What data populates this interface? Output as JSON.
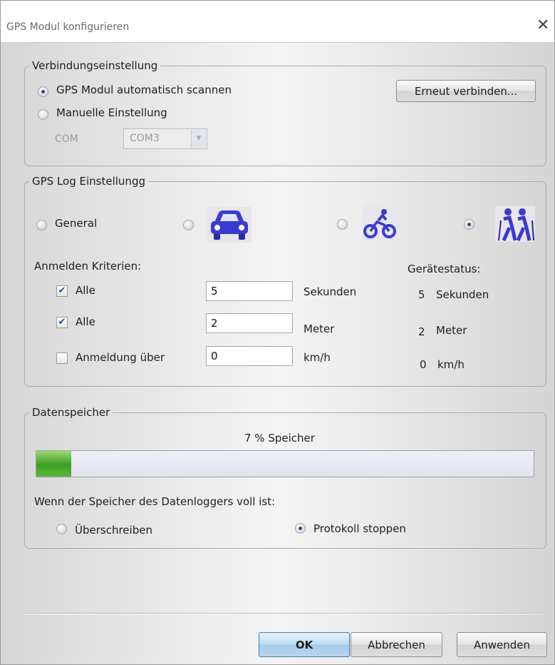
{
  "window": {
    "title": "GPS Modul konfigurieren"
  },
  "connection": {
    "legend": "Verbindungseinstellung",
    "auto_label": "GPS Modul automatisch scannen",
    "manual_label": "Manuelle Einstellung",
    "com_label": "COM",
    "com_value": "COM3",
    "reconnect_label": "Erneut verbinden...",
    "selected": "auto"
  },
  "log": {
    "legend": "GPS Log Einstellungg",
    "modes": [
      {
        "label": "General",
        "icon": "none"
      },
      {
        "label": "",
        "icon": "car-icon"
      },
      {
        "label": "",
        "icon": "bicycle-icon"
      },
      {
        "label": "",
        "icon": "hiking-icon"
      }
    ],
    "selected_mode": 3,
    "criteria_label": "Anmelden Kriterien:",
    "status_label": "Gerätestatus:",
    "criteria": [
      {
        "label": "Alle",
        "checked": true,
        "value": "5",
        "unit": "Sekunden",
        "status_value": "5",
        "status_unit": "Sekunden"
      },
      {
        "label": "Alle",
        "checked": true,
        "value": "2",
        "unit": "Meter",
        "status_value": "2",
        "status_unit": "Meter"
      },
      {
        "label": "Anmeldung über",
        "checked": false,
        "value": "0",
        "unit": "km/h",
        "status_value": "0",
        "status_unit": "km/h"
      }
    ]
  },
  "storage": {
    "legend": "Datenspeicher",
    "usage_text": "7 % Speicher",
    "usage_percent": 7,
    "full_label": "Wenn der Speicher des Datenloggers voll ist:",
    "overwrite_label": "Überschreiben",
    "stop_label": "Protokoll stoppen",
    "selected": "stop"
  },
  "buttons": {
    "ok": "OK",
    "cancel": "Abbrechen",
    "apply": "Anwenden"
  },
  "colors": {
    "accent": "#3c7fb1",
    "progress": "#3d9d22",
    "icon": "#3a3ad0"
  }
}
